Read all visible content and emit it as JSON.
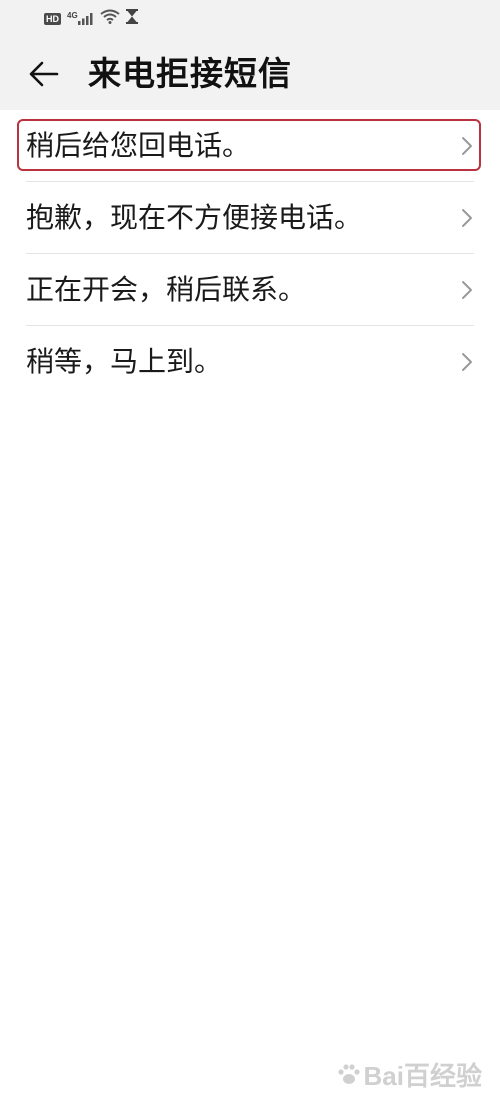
{
  "status_bar": {
    "hd_label": "HD",
    "network_label": "4G",
    "icons": [
      "hd-icon",
      "signal-icon",
      "wifi-icon",
      "hourglass-icon"
    ]
  },
  "header": {
    "title": "来电拒接短信",
    "back_icon": "back-arrow-icon"
  },
  "messages": [
    {
      "label": "稍后给您回电话。",
      "selected": true
    },
    {
      "label": "抱歉，现在不方便接电话。",
      "selected": false
    },
    {
      "label": "正在开会，稍后联系。",
      "selected": false
    },
    {
      "label": "稍等，马上到。",
      "selected": false
    }
  ],
  "watermark": {
    "text": "Bai百经验"
  },
  "colors": {
    "header_bg": "#f2f2f2",
    "highlight": "#b8333f",
    "chevron": "#9a9a9a",
    "divider": "#e4e4e4"
  }
}
